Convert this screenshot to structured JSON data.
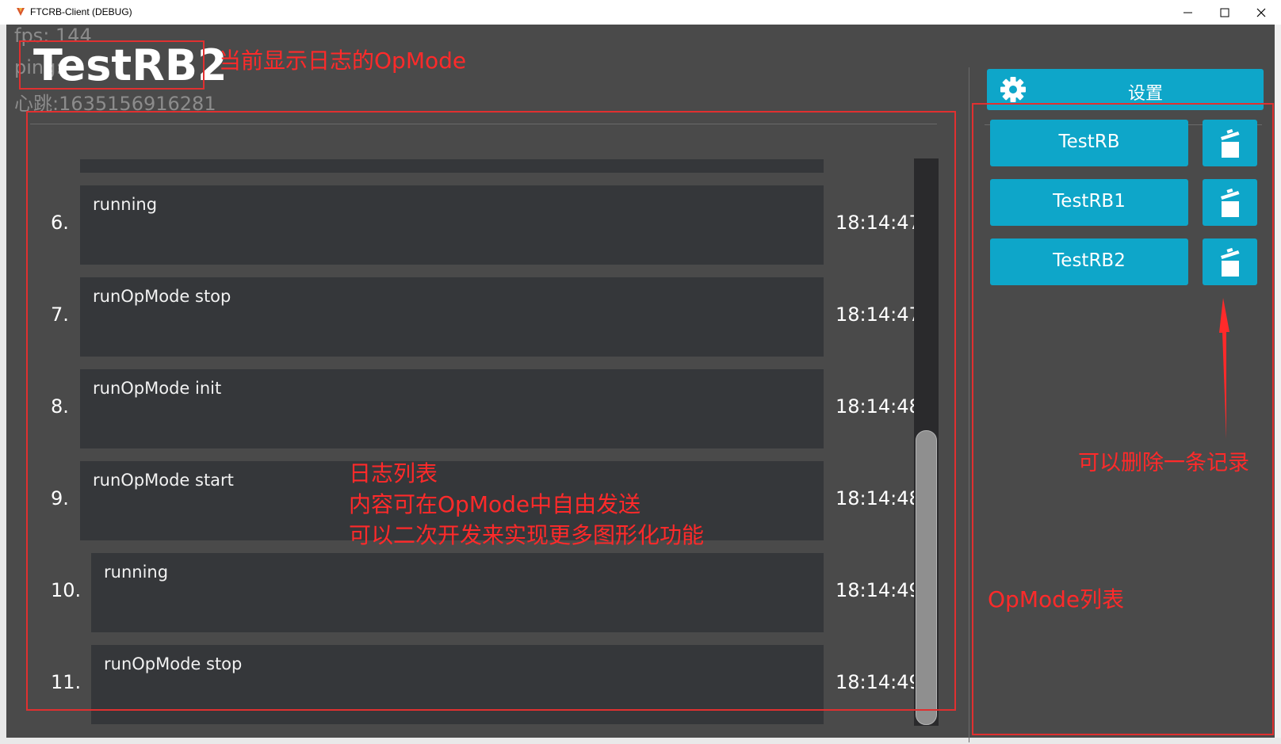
{
  "window": {
    "title": "FTCRB-Client (DEBUG)"
  },
  "debug": {
    "fps": "fps: 144",
    "ping": "ping:",
    "heartbeat": "心跳:1635156916281"
  },
  "header": {
    "current_opmode": "TestRB2"
  },
  "logs": [
    {
      "index": "6.",
      "message": "running",
      "time": "18:14:47"
    },
    {
      "index": "7.",
      "message": "runOpMode stop",
      "time": "18:14:47"
    },
    {
      "index": "8.",
      "message": "runOpMode init",
      "time": "18:14:48"
    },
    {
      "index": "9.",
      "message": "runOpMode start",
      "time": "18:14:48"
    },
    {
      "index": "10.",
      "message": "running",
      "time": "18:14:49"
    },
    {
      "index": "11.",
      "message": "runOpMode stop",
      "time": "18:14:49"
    }
  ],
  "sidebar": {
    "settings_label": "设置",
    "settings_icon": "gear-icon",
    "delete_icon": "trash-icon",
    "opmodes": [
      {
        "label": "TestRB"
      },
      {
        "label": "TestRB1"
      },
      {
        "label": "TestRB2"
      }
    ]
  },
  "annotations": {
    "current_opmode_note": "当前显示日志的OpMode",
    "log_list_note": [
      "日志列表",
      "内容可在OpMode中自由发送",
      "可以二次开发来实现更多图形化功能"
    ],
    "delete_note": "可以删除一条记录",
    "opmode_list_note": "OpMode列表"
  },
  "colors": {
    "accent": "#0ea6c9",
    "background": "#4a4a4a",
    "card": "#35373a",
    "annotation": "#e03030"
  }
}
